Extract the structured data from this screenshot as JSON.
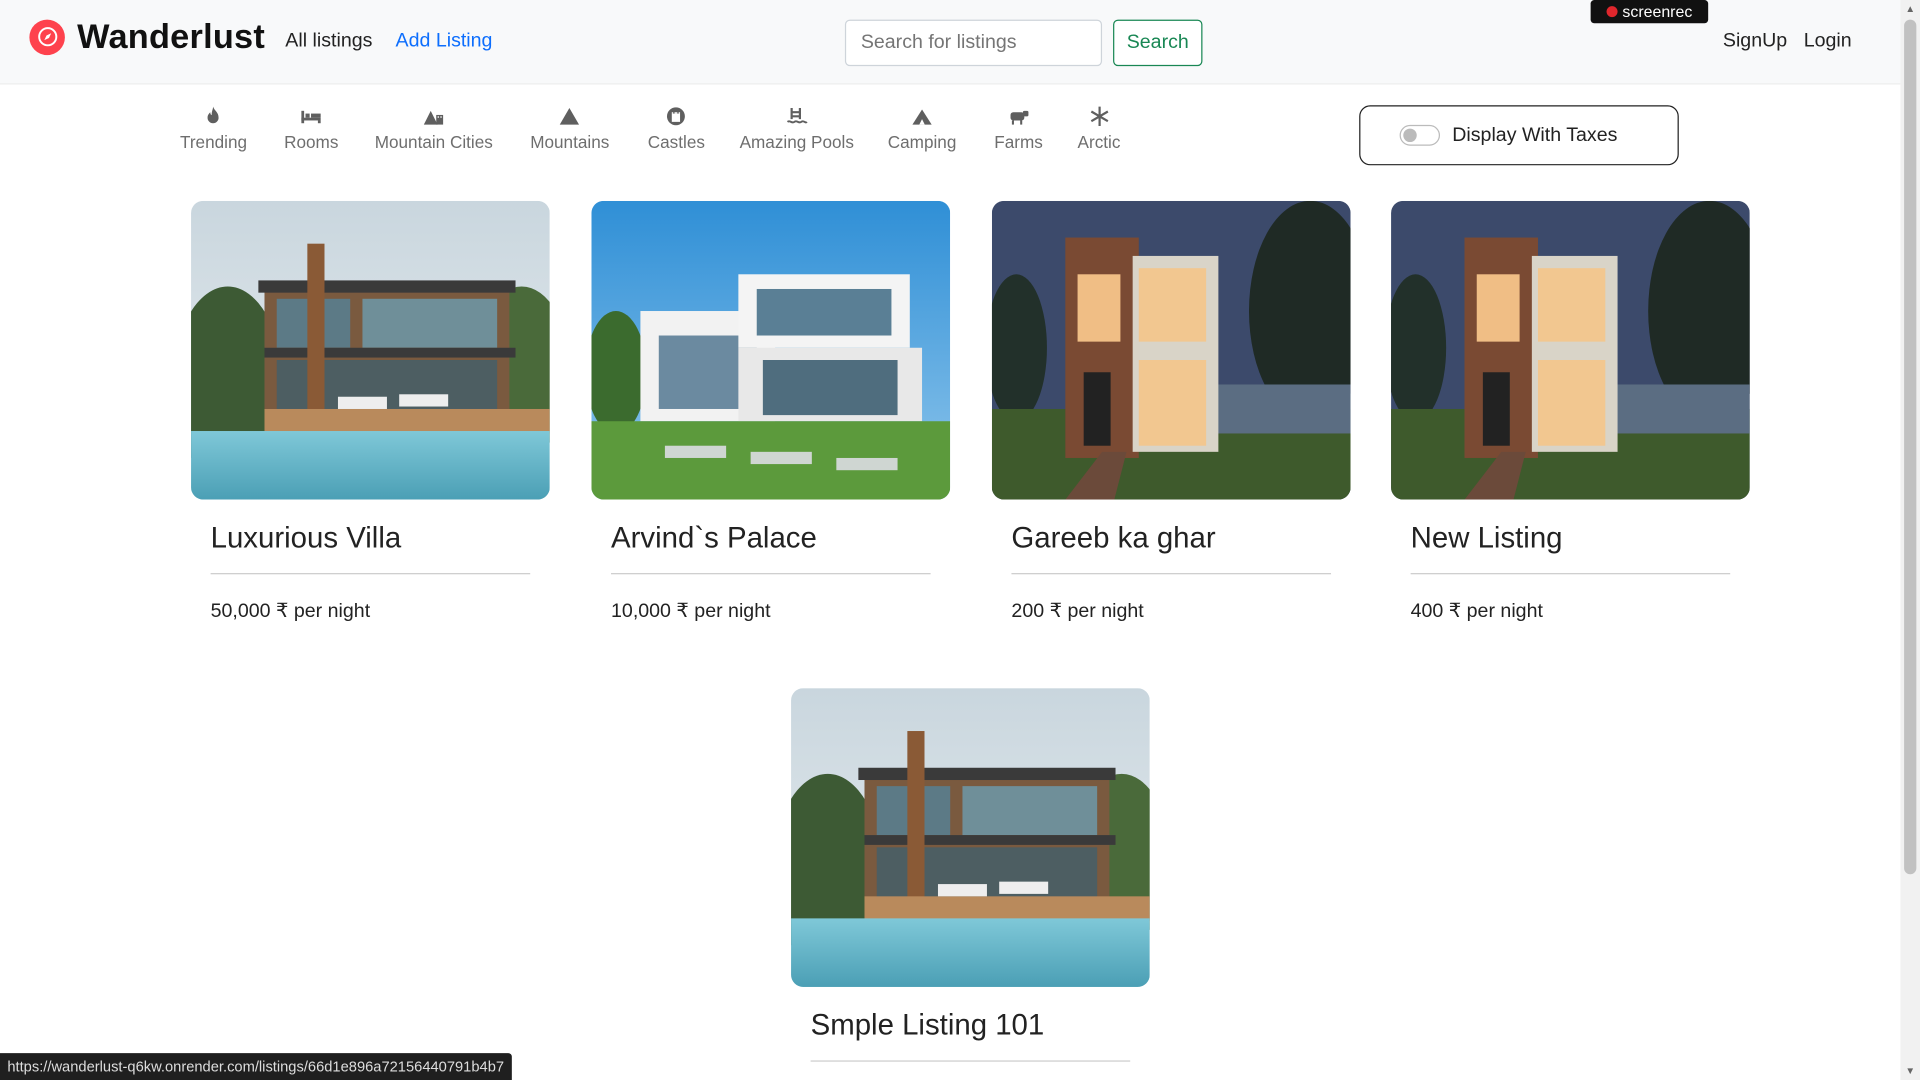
{
  "brand": {
    "name": "Wanderlust",
    "color": "#fe424d"
  },
  "nav": {
    "all_listings": "All listings",
    "add_listing": "Add Listing"
  },
  "search": {
    "placeholder": "Search for listings",
    "button": "Search"
  },
  "recorder": {
    "label": "screenrec"
  },
  "auth": {
    "signup": "SignUp",
    "login": "Login"
  },
  "filters": [
    {
      "label": "Trending",
      "icon": "fire-icon"
    },
    {
      "label": "Rooms",
      "icon": "bed-icon"
    },
    {
      "label": "Mountain Cities",
      "icon": "mountain-city-icon"
    },
    {
      "label": "Mountains",
      "icon": "mountain-icon"
    },
    {
      "label": "Castles",
      "icon": "castle-icon"
    },
    {
      "label": "Amazing Pools",
      "icon": "pool-icon"
    },
    {
      "label": "Camping",
      "icon": "campground-icon"
    },
    {
      "label": "Farms",
      "icon": "cow-icon"
    },
    {
      "label": "Arctic",
      "icon": "snowflake-icon"
    }
  ],
  "tax_toggle": {
    "label": "Display With Taxes",
    "on": false
  },
  "listings": [
    {
      "title": "Luxurious Villa",
      "price": "50,000 ₹ per night",
      "image": "villa-pool"
    },
    {
      "title": "Arvind`s Palace",
      "price": "10,000 ₹ per night",
      "image": "white-modern-house"
    },
    {
      "title": "Gareeb ka ghar",
      "price": "200 ₹ per night",
      "image": "brick-house-night"
    },
    {
      "title": "New Listing",
      "price": "400 ₹ per night",
      "image": "brick-house-night"
    },
    {
      "title": "Smple Listing 101",
      "price": "",
      "image": "villa-pool"
    }
  ],
  "status_url": "https://wanderlust-q6kw.onrender.com/listings/66d1e896a72156440791b4b7"
}
